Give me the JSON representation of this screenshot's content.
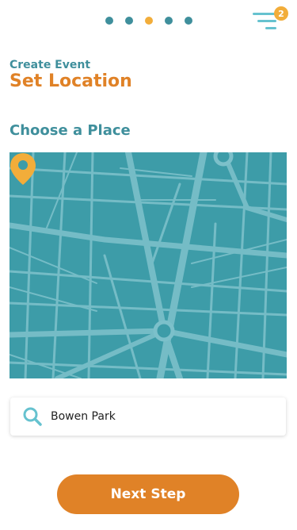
{
  "header": {
    "steps": [
      {
        "state": "done"
      },
      {
        "state": "done"
      },
      {
        "state": "current"
      },
      {
        "state": "upcoming"
      },
      {
        "state": "upcoming"
      }
    ],
    "menu_badge": "2"
  },
  "page": {
    "eyebrow": "Create Event",
    "title": "Set Location",
    "section_title": "Choose a Place"
  },
  "search": {
    "value": "Bowen Park"
  },
  "footer": {
    "next_label": "Next Step"
  },
  "colors": {
    "teal": "#3f8f9c",
    "orange": "#e08227",
    "yellow": "#f2ad3a",
    "map_bg": "#3d9ca8"
  }
}
